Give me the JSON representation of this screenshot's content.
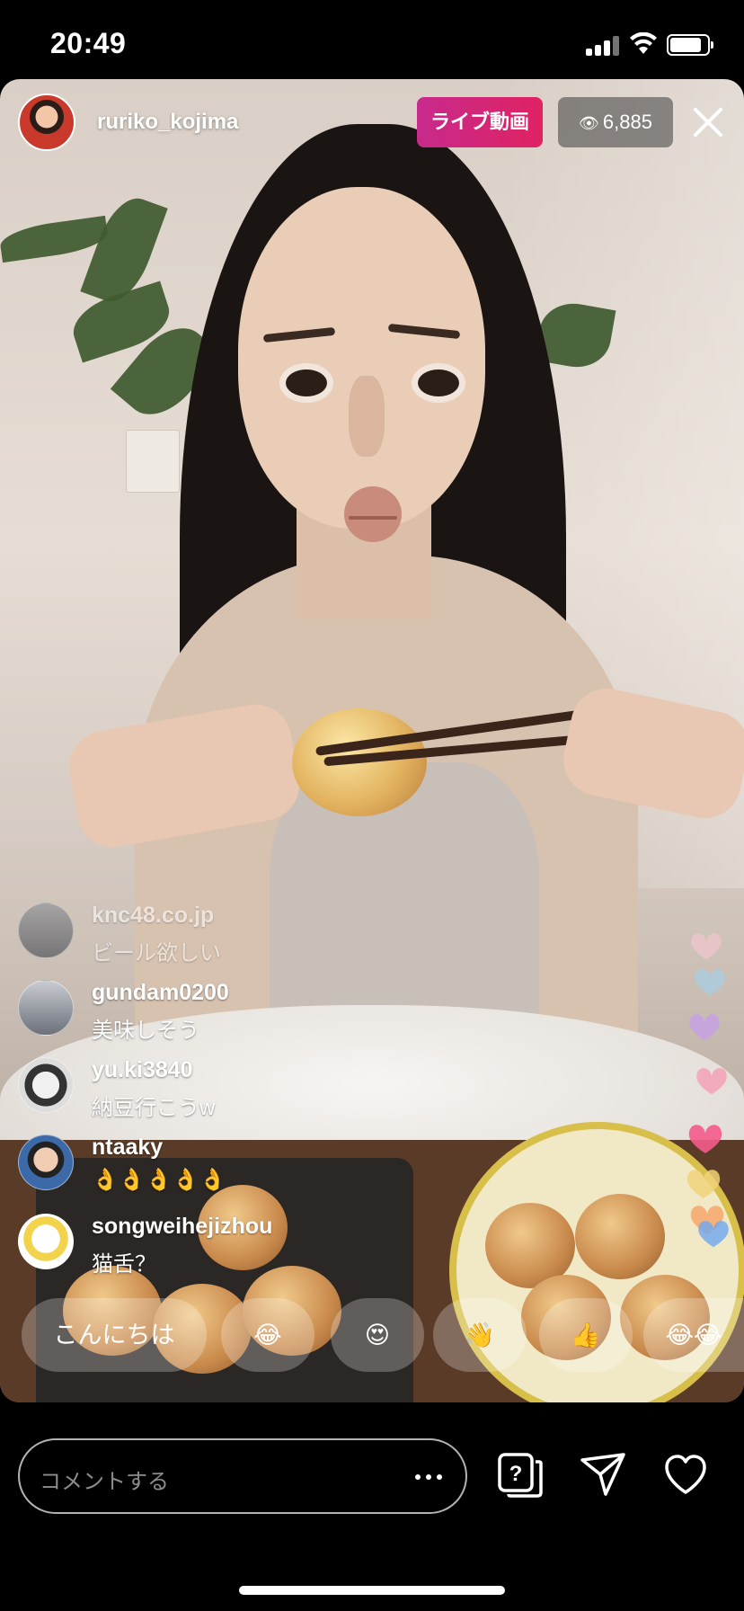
{
  "status_bar": {
    "time": "20:49",
    "signal_icon": "cellular-signal-icon",
    "wifi_icon": "wifi-icon",
    "battery_icon": "battery-icon",
    "battery_level": 0.85
  },
  "live": {
    "host_username": "ruriko_kojima",
    "live_badge": "ライブ動画",
    "viewer_count": "6,885",
    "viewer_icon": "eye-icon",
    "close_icon": "close-icon"
  },
  "comments": [
    {
      "username": "knc48.co.jp",
      "text": "ビール欲しい",
      "faded": true
    },
    {
      "username": "gundam0200",
      "text": "美味しそう",
      "faded": false
    },
    {
      "username": "yu.ki3840",
      "text": "納豆行こうw",
      "faded": false
    },
    {
      "username": "ntaaky",
      "text": "👌👌👌👌👌",
      "faded": false
    },
    {
      "username": "songweihejizhou",
      "text": "猫舌？",
      "faded": false
    }
  ],
  "quick_reactions": [
    {
      "label": "こんにちは",
      "type": "text"
    },
    {
      "label": "😂",
      "type": "emoji"
    },
    {
      "label": "😍",
      "type": "emoji"
    },
    {
      "label": "👋",
      "type": "emoji"
    },
    {
      "label": "👍",
      "type": "emoji"
    },
    {
      "label": "😂😂",
      "type": "emoji"
    }
  ],
  "bottom_bar": {
    "comment_placeholder": "コメントする",
    "more_icon": "more-dots-icon",
    "question_icon": "question-sticker-icon",
    "send_icon": "send-icon",
    "like_icon": "heart-icon"
  },
  "colors": {
    "live_badge": "#d8226e",
    "hearts": [
      "#ffc7d8",
      "#9ad3f5",
      "#f59ab3",
      "#c69af5",
      "#f55c8c",
      "#f2d37a",
      "#a7e3a2",
      "#f7a86b",
      "#6fa8f0"
    ]
  }
}
